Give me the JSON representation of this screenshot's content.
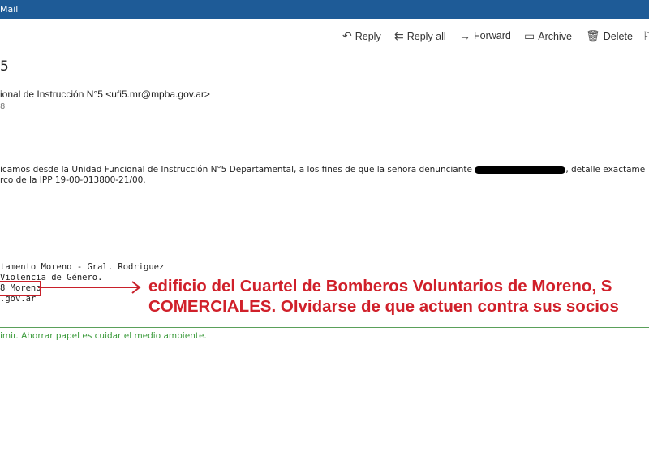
{
  "window": {
    "title": "Mail"
  },
  "toolbar": {
    "reply": "Reply",
    "reply_all": "Reply all",
    "forward": "Forward",
    "archive": "Archive",
    "delete": "Delete"
  },
  "email": {
    "subject": "5",
    "sender": "ional de Instrucción N°5 <ufi5.mr@mpba.gov.ar>",
    "date": "8",
    "body_line1": "icamos desde la Unidad Funcional de Instrucción N°5 Departamental, a los fines de que la señora denunciante",
    "body_line1_end": ", detalle exactame",
    "body_line2": "rco de la IPP 19-00-013800-21/00.",
    "signature": [
      "tamento Moreno - Gral. Rodriguez",
      "Violencia de Género.",
      "8 Moreno",
      ".gov.ar"
    ],
    "footer": "imir. Ahorrar papel es cuidar el medio ambiente."
  },
  "annotation": {
    "line1": "edificio del Cuartel de Bomberos Voluntarios de Moreno, S",
    "line2": "COMERCIALES. Olvidarse de que actuen contra sus socios",
    "color": "#d0202a"
  }
}
